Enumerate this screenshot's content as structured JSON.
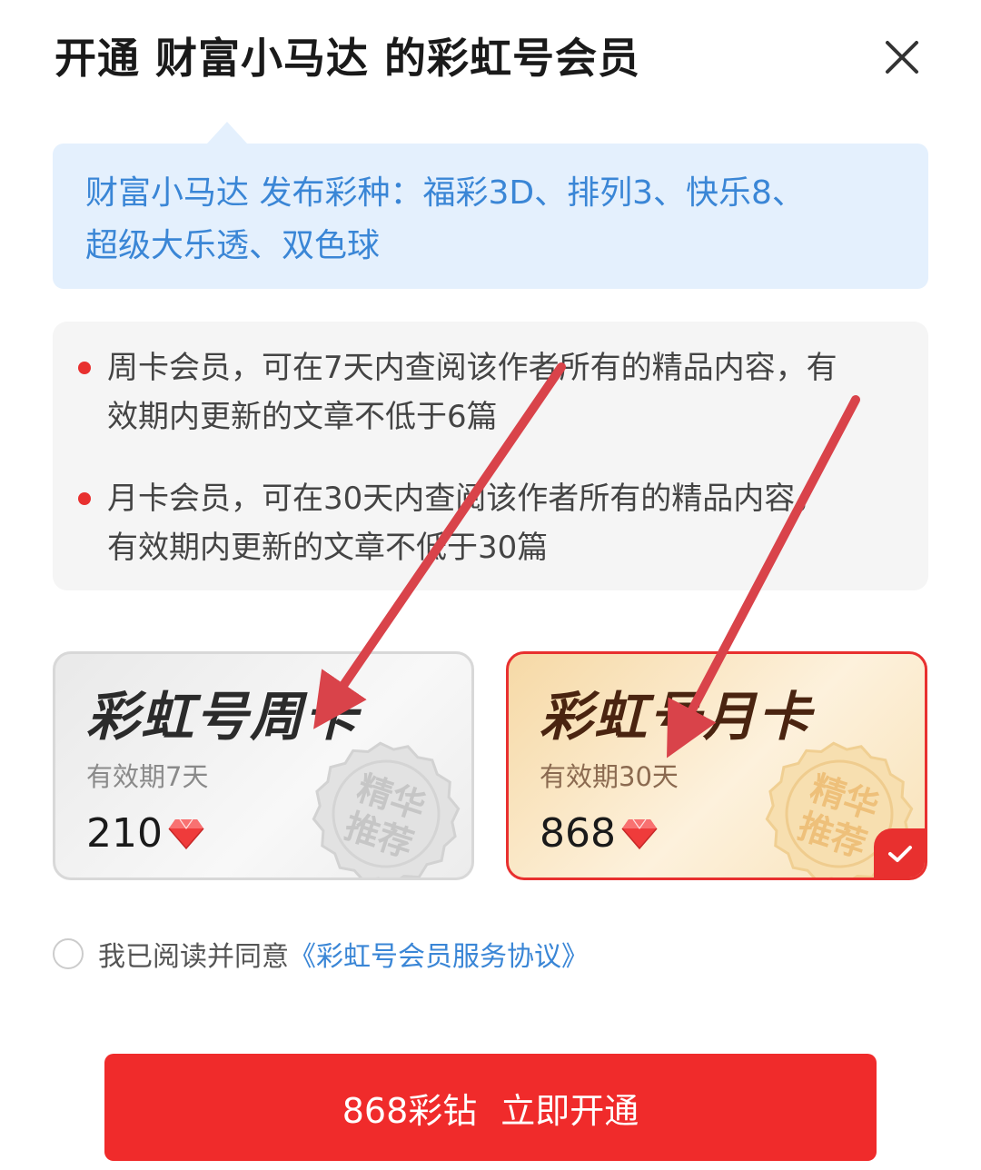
{
  "dialog": {
    "title": "开通 财富小马达 的彩虹号会员",
    "close_icon": "close-icon"
  },
  "info": {
    "line1": "财富小马达 发布彩种：福彩3D、排列3、快乐8、",
    "line2": "超级大乐透、双色球"
  },
  "rules": [
    {
      "line1": "周卡会员，可在7天内查阅该作者所有的精品内容，有",
      "line2": "效期内更新的文章不低于6篇"
    },
    {
      "line1": "月卡会员，可在30天内查阅该作者所有的精品内容，",
      "line2": "有效期内更新的文章不低于30篇"
    }
  ],
  "plans": [
    {
      "name": "彩虹号周卡",
      "validity": "有效期7天",
      "price": "210",
      "badge_line1": "精华",
      "badge_line2": "推荐",
      "selected": false
    },
    {
      "name": "彩虹号月卡",
      "validity": "有效期30天",
      "price": "868",
      "badge_line1": "精华",
      "badge_line2": "推荐",
      "selected": true
    }
  ],
  "agreement": {
    "checked": false,
    "text": "我已阅读并同意",
    "link": "《彩虹号会员服务协议》"
  },
  "cta": {
    "price_label": "868彩钻",
    "action_label": "立即开通"
  },
  "colors": {
    "accent": "#f02b2b",
    "link": "#3a86d6",
    "info_bg": "#e4f0fd",
    "arrow": "#d9434a"
  }
}
